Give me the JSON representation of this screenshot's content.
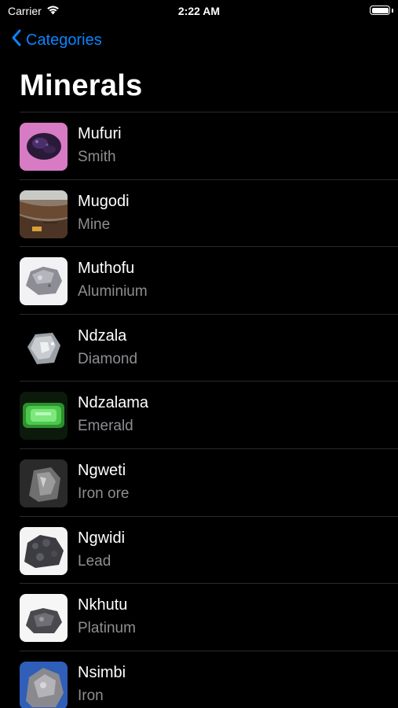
{
  "status": {
    "carrier": "Carrier",
    "time": "2:22 AM",
    "battery_level": 1.0
  },
  "nav": {
    "back_label": "Categories"
  },
  "title": "Minerals",
  "colors": {
    "accent": "#0a84ff",
    "background": "#000000",
    "secondary_text": "#8e8e93",
    "separator": "#2a2a2c"
  },
  "items": [
    {
      "name": "Mufuri",
      "subtitle": "Smith",
      "thumb_icon": "purple-mineral-photo"
    },
    {
      "name": "Mugodi",
      "subtitle": "Mine",
      "thumb_icon": "open-pit-mine-photo"
    },
    {
      "name": "Muthofu",
      "subtitle": "Aluminium",
      "thumb_icon": "aluminium-ore-photo"
    },
    {
      "name": "Ndzala",
      "subtitle": "Diamond",
      "thumb_icon": "diamond-photo"
    },
    {
      "name": "Ndzalama",
      "subtitle": "Emerald",
      "thumb_icon": "emerald-photo"
    },
    {
      "name": "Ngweti",
      "subtitle": "Iron ore",
      "thumb_icon": "iron-ore-photo"
    },
    {
      "name": "Ngwidi",
      "subtitle": "Lead",
      "thumb_icon": "lead-ore-photo"
    },
    {
      "name": "Nkhutu",
      "subtitle": "Platinum",
      "thumb_icon": "platinum-ore-photo"
    },
    {
      "name": "Nsimbi",
      "subtitle": "Iron",
      "thumb_icon": "iron-photo"
    }
  ]
}
